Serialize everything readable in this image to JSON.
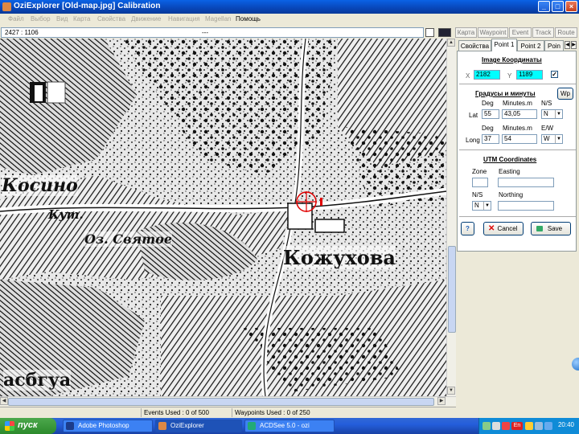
{
  "window": {
    "title": "OziExplorer [Old-map.jpg] Calibration"
  },
  "menu": [
    {
      "label": "Файл",
      "enabled": false
    },
    {
      "label": "Выбор",
      "enabled": false
    },
    {
      "label": "Вид",
      "enabled": false
    },
    {
      "label": "Карта",
      "enabled": false
    },
    {
      "label": "Свойства",
      "enabled": false
    },
    {
      "label": "Движение",
      "enabled": false
    },
    {
      "label": "Навигация",
      "enabled": false
    },
    {
      "label": "Magellan",
      "enabled": false
    },
    {
      "label": "Помощь",
      "enabled": true
    }
  ],
  "toolbar": {
    "cursor_coords": "2427 : 1106",
    "separator": "---",
    "tabs": [
      "Карта",
      "Waypoint",
      "Event",
      "Track",
      "Route"
    ]
  },
  "map": {
    "labels": [
      "Косино",
      "Кут.",
      "Оз. Святое",
      "Кожухова",
      "асбгуа"
    ]
  },
  "status": {
    "events": "Events Used : 0 of 500",
    "waypoints": "Waypoints Used : 0 of 250"
  },
  "panel": {
    "tabs": [
      "Свойства",
      "Point 1",
      "Point 2",
      "Poin"
    ],
    "image_section": "Image Координаты",
    "x_label": "X",
    "x_value": "2182",
    "y_label": "Y",
    "y_value": "1189",
    "use_checked": true,
    "deg_section": "Градусы и минуты",
    "wp_button": "Wp",
    "col_deg": "Deg",
    "col_minutes": "Minutes.m",
    "col_ns": "N/S",
    "col_ew": "E/W",
    "lat_label": "Lat",
    "lat_deg": "55",
    "lat_min": "43,05",
    "lat_ns": "N",
    "long_label": "Long",
    "long_deg": "37",
    "long_min": "54",
    "long_ew": "W",
    "utm_section": "UTM Coordinates",
    "zone_label": "Zone",
    "easting_label": "Easting",
    "ns_label": "N/S",
    "northing_label": "Northing",
    "utm_ns": "N",
    "help_button": "?",
    "cancel_button": "Cancel",
    "save_button": "Save"
  },
  "taskbar": {
    "start": "пуск",
    "tasks": [
      "Adobe Photoshop",
      "OziExplorer",
      "ACDSee 5.0 - ozi"
    ],
    "lang": "En",
    "clock": "20:40"
  },
  "colors": {
    "title_blue": "#0a62e6",
    "highlight_cyan": "#00ffff",
    "taskbar_blue": "#245edb",
    "start_green": "#3c9a3c",
    "marker_red": "#e00000"
  }
}
